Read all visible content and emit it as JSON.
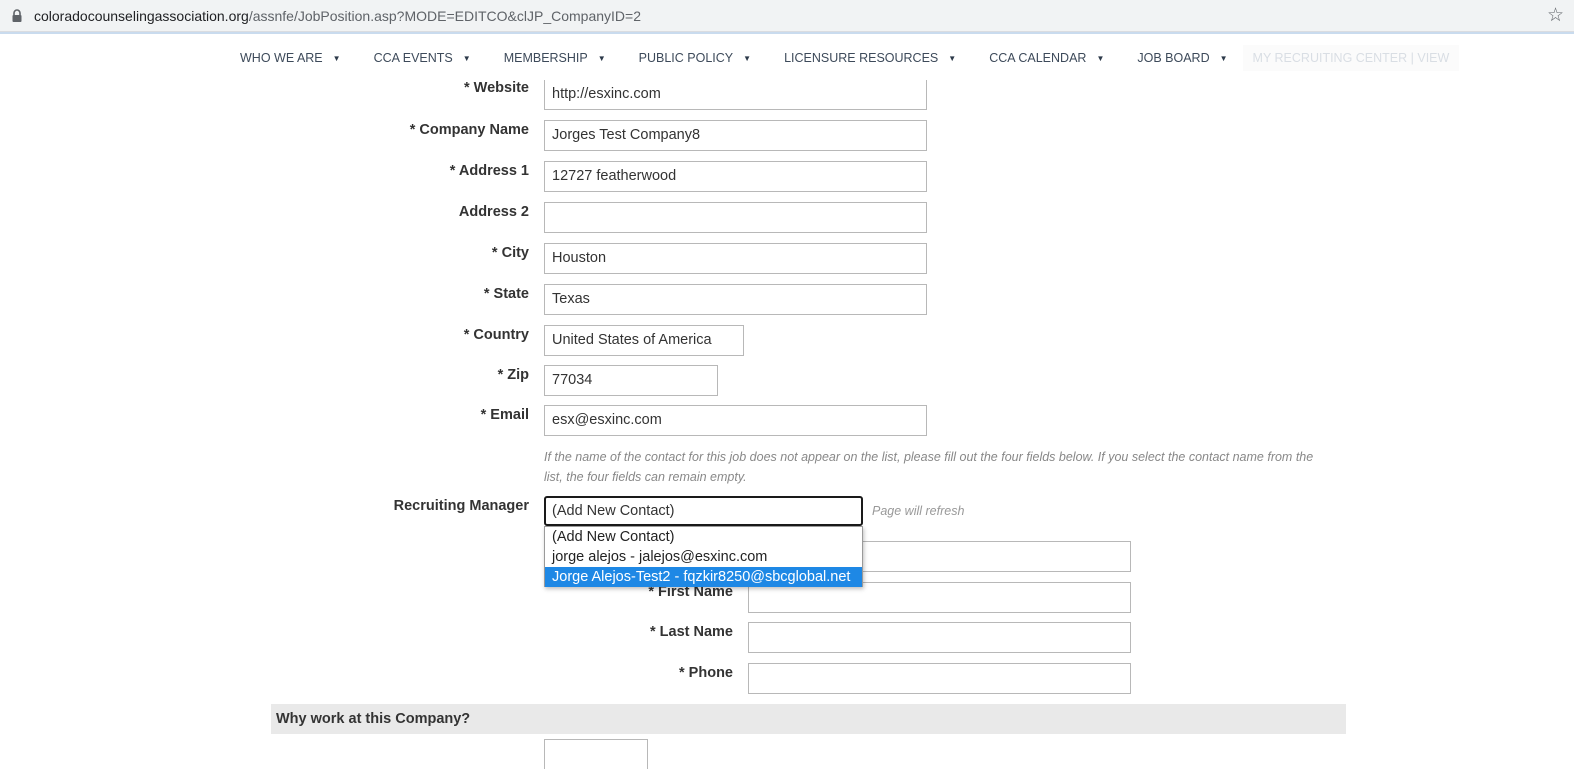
{
  "browser": {
    "url_host": "coloradocounselingassociation.org",
    "url_path": "/assnfe/JobPosition.asp?MODE=EDITCO&clJP_CompanyID=2"
  },
  "nav": {
    "items": [
      {
        "label": "WHO WE ARE"
      },
      {
        "label": "CCA EVENTS"
      },
      {
        "label": "MEMBERSHIP"
      },
      {
        "label": "PUBLIC POLICY"
      },
      {
        "label": "LICENSURE RESOURCES"
      },
      {
        "label": "CCA CALENDAR"
      },
      {
        "label": "JOB BOARD"
      }
    ],
    "faded": "MY RECRUITING CENTER | VIEW"
  },
  "form": {
    "website": {
      "label": "* Website",
      "value": "http://esxinc.com"
    },
    "company_name": {
      "label": "* Company Name",
      "value": "Jorges Test Company8"
    },
    "address1": {
      "label": "* Address 1",
      "value": "12727 featherwood"
    },
    "address2": {
      "label": "Address 2",
      "value": ""
    },
    "city": {
      "label": "* City",
      "value": "Houston"
    },
    "state": {
      "label": "* State",
      "value": "Texas"
    },
    "country": {
      "label": "* Country",
      "value": "United States of America"
    },
    "zip": {
      "label": "* Zip",
      "value": "77034"
    },
    "email": {
      "label": "* Email",
      "value": "esx@esxinc.com"
    },
    "note": "If the name of the contact for this job does not appear on the list, please fill out the four fields below. If you select the contact name from the list, the four fields can remain empty.",
    "recruiting_manager": {
      "label": "Recruiting Manager",
      "selected": "(Add New Contact)",
      "hint": "Page will refresh",
      "options": [
        "(Add New Contact)",
        "jorge alejos - jalejos@esxinc.com",
        "Jorge Alejos-Test2 - fqzkir8250@sbcglobal.net"
      ]
    },
    "first_name": {
      "label": "* First Name",
      "value": ""
    },
    "last_name": {
      "label": "* Last Name",
      "value": ""
    },
    "phone": {
      "label": "* Phone",
      "value": ""
    },
    "contact_email": {
      "value": ""
    }
  },
  "section": {
    "why_work": "Why work at this Company?"
  }
}
